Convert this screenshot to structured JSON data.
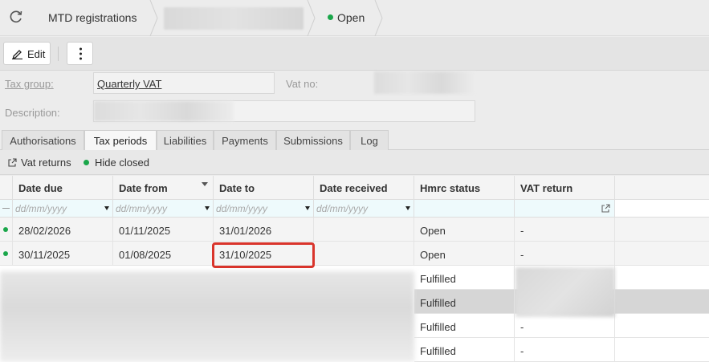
{
  "breadcrumb": {
    "title": "MTD registrations",
    "status": "Open",
    "refresh_icon": "refresh-icon"
  },
  "toolbar": {
    "edit_label": "Edit",
    "edit_icon": "pencil-icon",
    "more_icon": "kebab-menu-icon"
  },
  "form": {
    "tax_group_label": "Tax group:",
    "tax_group_value": "Quarterly VAT",
    "vat_no_label": "Vat no:",
    "description_label": "Description:"
  },
  "tabs": [
    {
      "label": "Authorisations",
      "active": false
    },
    {
      "label": "Tax periods",
      "active": true
    },
    {
      "label": "Liabilities",
      "active": false
    },
    {
      "label": "Payments",
      "active": false
    },
    {
      "label": "Submissions",
      "active": false
    },
    {
      "label": "Log",
      "active": false
    }
  ],
  "subbar": {
    "vat_returns_label": "Vat returns",
    "hide_closed_label": "Hide closed"
  },
  "grid": {
    "columns": [
      "Date due",
      "Date from",
      "Date to",
      "Date received",
      "Hmrc status",
      "VAT return"
    ],
    "filter_placeholder": "dd/mm/yyyy",
    "rows": [
      {
        "date_due": "28/02/2026",
        "date_from": "01/11/2025",
        "date_to": "31/01/2026",
        "date_received": "",
        "hmrc_status": "Open",
        "vat_return": "-"
      },
      {
        "date_due": "30/11/2025",
        "date_from": "01/08/2025",
        "date_to": "31/10/2025",
        "date_received": "",
        "hmrc_status": "Open",
        "vat_return": "-"
      },
      {
        "hmrc_status": "Fulfilled",
        "vat_return": ""
      },
      {
        "hmrc_status": "Fulfilled",
        "vat_return": ""
      },
      {
        "hmrc_status": "Fulfilled",
        "vat_return": "-"
      },
      {
        "hmrc_status": "Fulfilled",
        "vat_return": "-"
      }
    ]
  },
  "colors": {
    "status_green": "#1aa64a",
    "highlight_red": "#d9342b"
  }
}
